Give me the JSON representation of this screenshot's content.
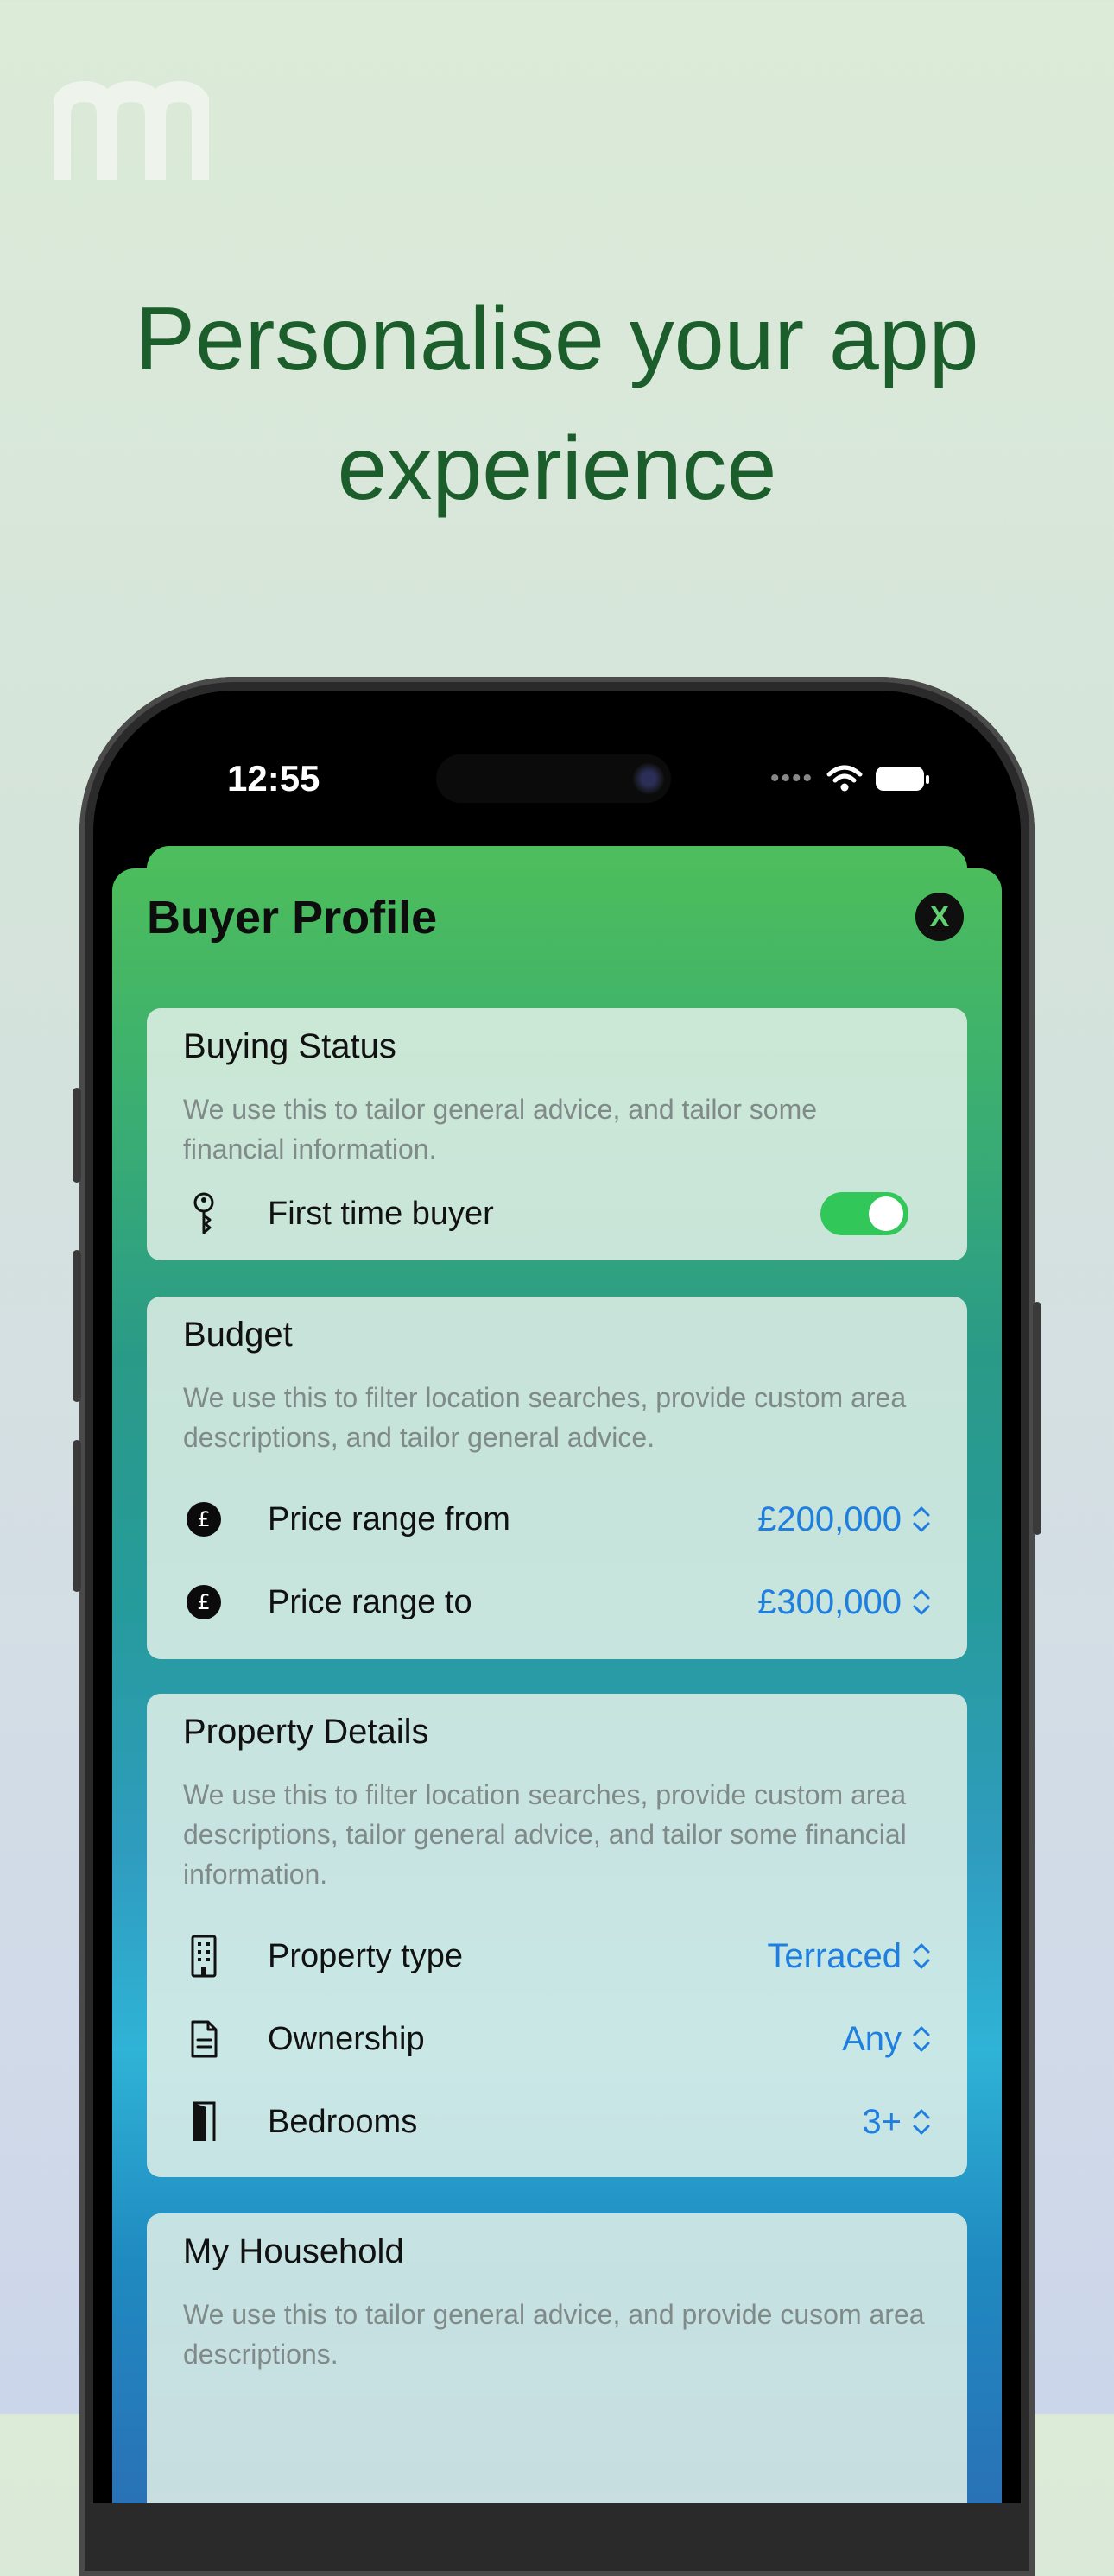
{
  "headline": {
    "line1": "Personalise your app",
    "line2": "experience"
  },
  "status_bar": {
    "time": "12:55"
  },
  "sheet": {
    "title": "Buyer Profile",
    "close_label": "X"
  },
  "buying_status": {
    "title": "Buying Status",
    "description": "We use this to tailor general advice, and tailor some financial information.",
    "first_time_buyer": {
      "label": "First time buyer",
      "icon": "key-icon",
      "on": true
    }
  },
  "budget": {
    "title": "Budget",
    "description": "We use this to filter location searches, provide custom area descriptions, and tailor general advice.",
    "from": {
      "label": "Price range from",
      "value": "£200,000",
      "icon": "pound-icon"
    },
    "to": {
      "label": "Price range to",
      "value": "£300,000",
      "icon": "pound-icon"
    }
  },
  "property_details": {
    "title": "Property Details",
    "description": "We use this to filter location searches, provide custom area descriptions, tailor general advice, and tailor some financial information.",
    "type": {
      "label": "Property type",
      "value": "Terraced",
      "icon": "building-icon"
    },
    "ownership": {
      "label": "Ownership",
      "value": "Any",
      "icon": "document-icon"
    },
    "bedrooms": {
      "label": "Bedrooms",
      "value": "3+",
      "icon": "door-icon"
    }
  },
  "household": {
    "title": "My Household",
    "description": "We use this to tailor general advice, and provide cusom area descriptions."
  },
  "colors": {
    "accent_blue": "#1f7fe0",
    "toggle_green": "#32c759",
    "headline_green": "#1b5e2c"
  }
}
